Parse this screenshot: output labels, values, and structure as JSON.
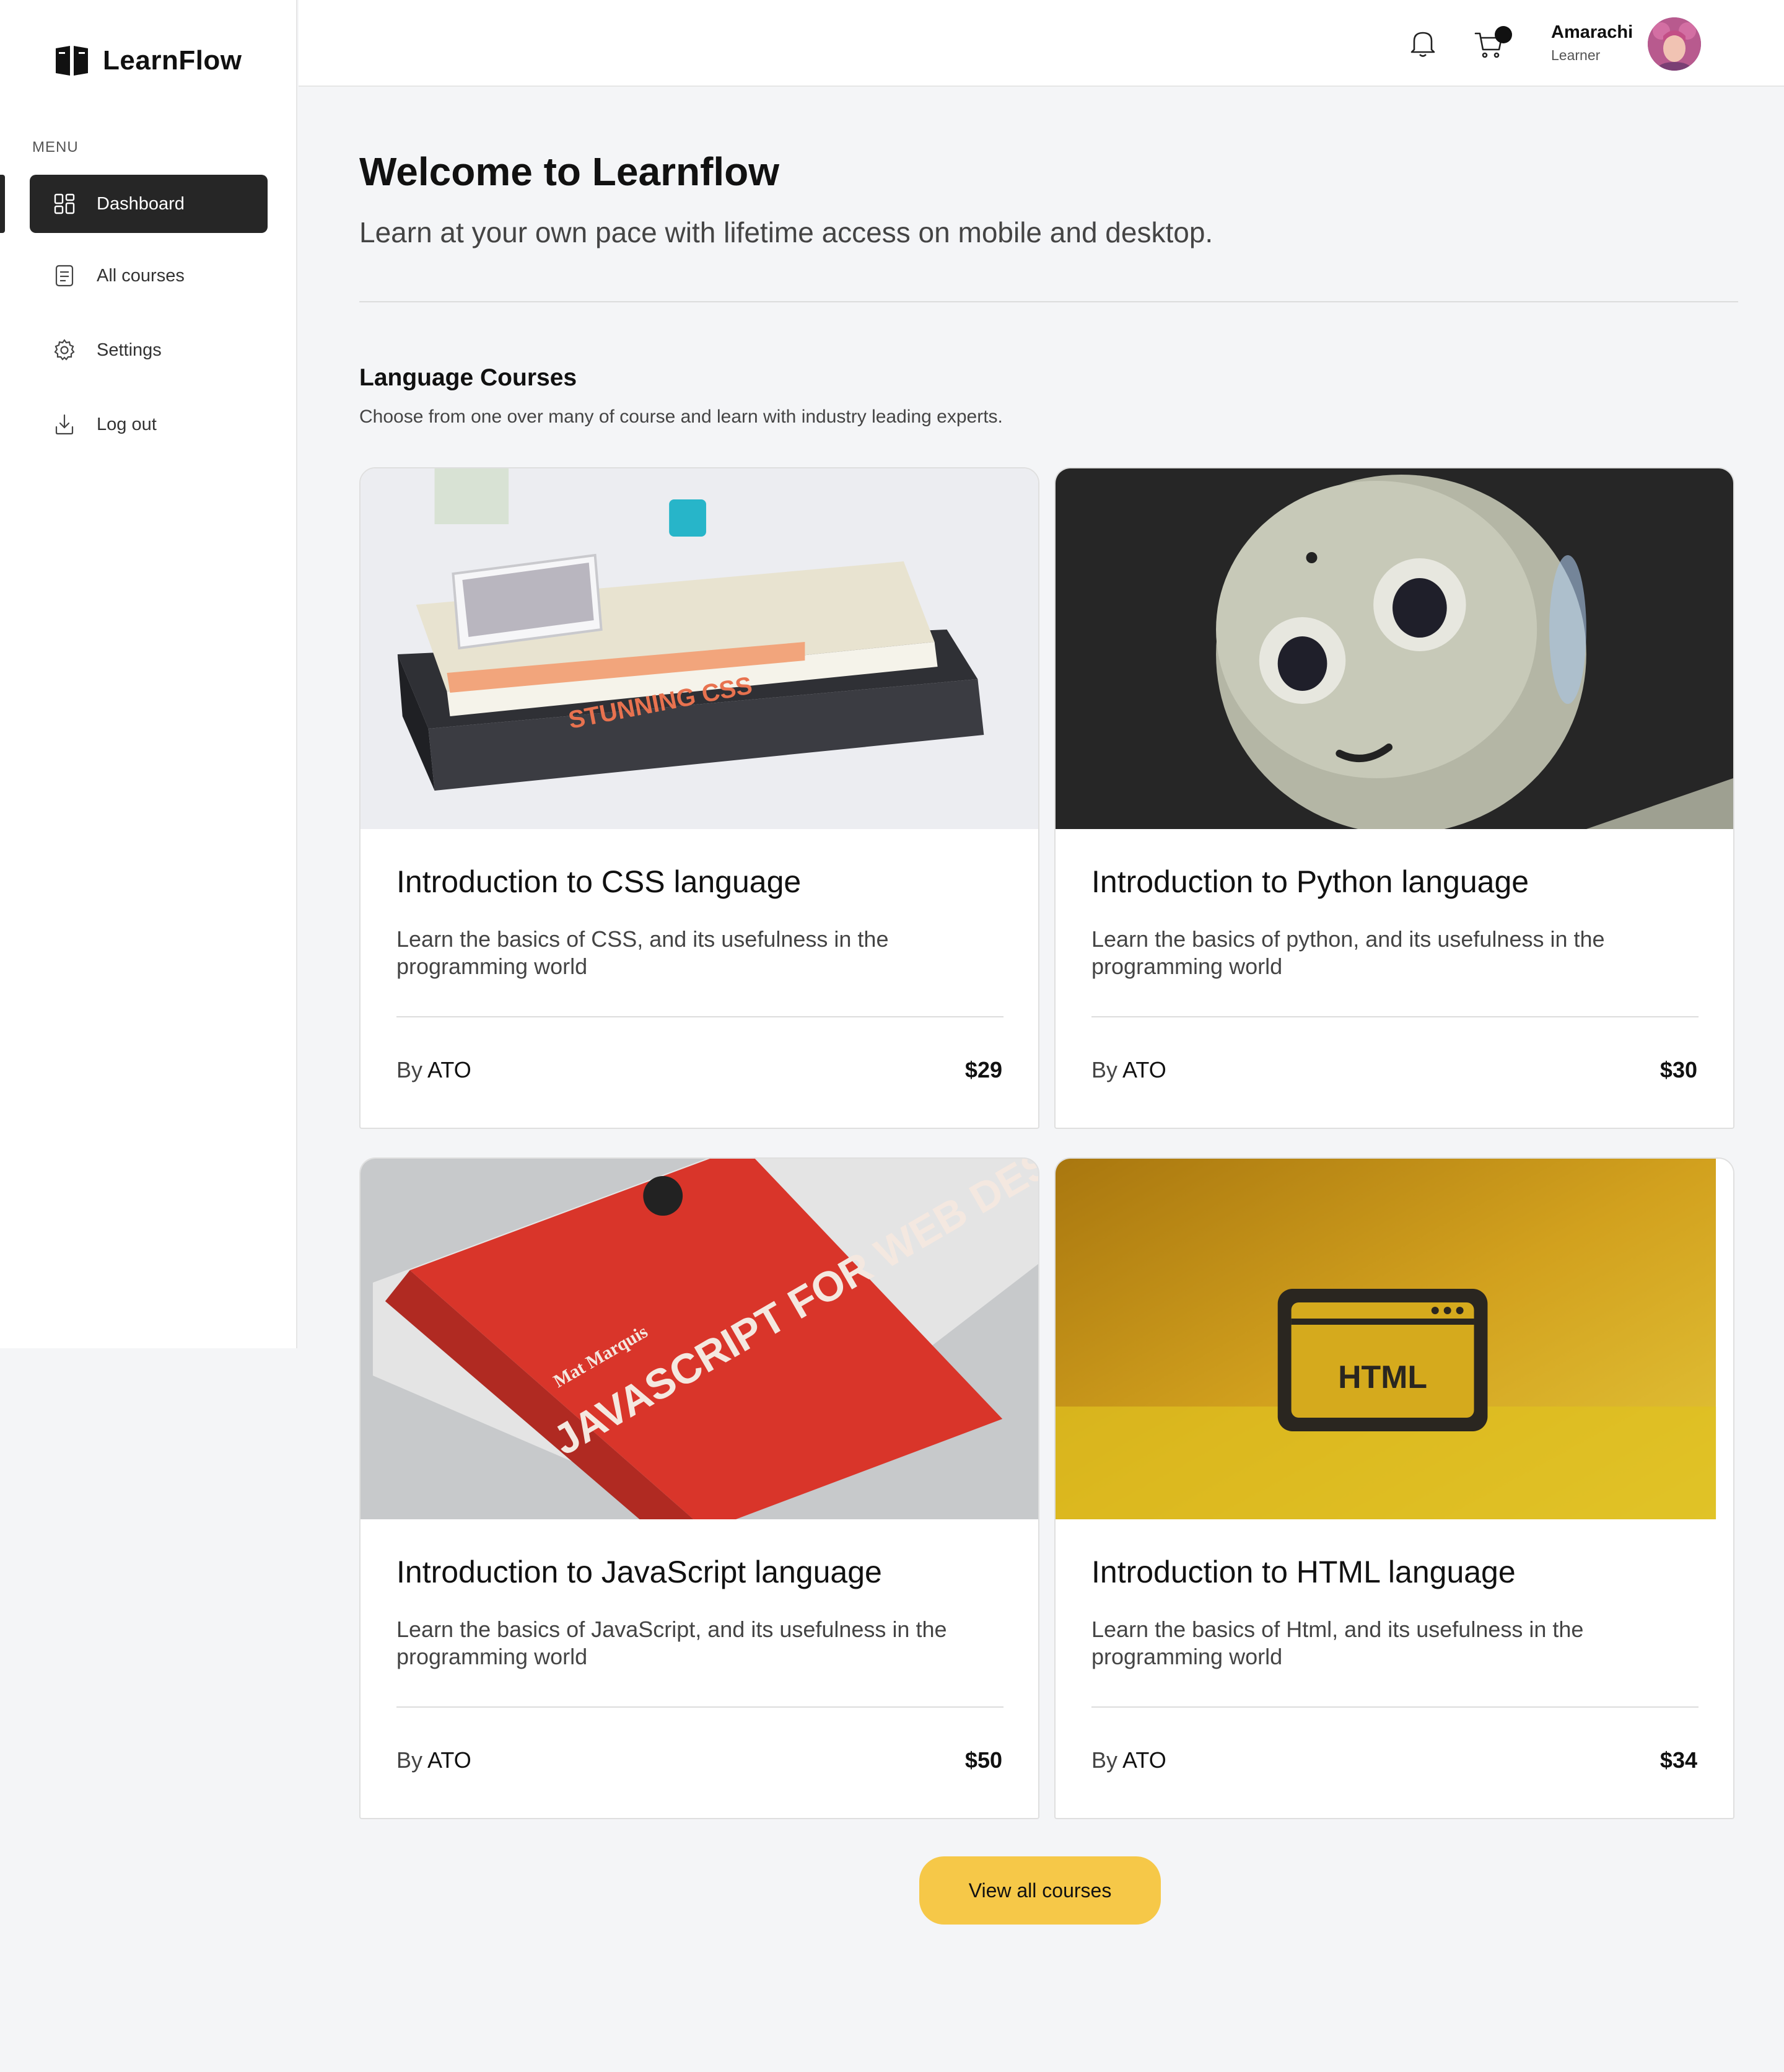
{
  "brand": {
    "name": "LearnFlow",
    "logo_icon": "open-book-icon"
  },
  "sidebar": {
    "menu_label": "MENU",
    "items": [
      {
        "label": "Dashboard",
        "icon": "dashboard-icon",
        "active": true
      },
      {
        "label": "All courses",
        "icon": "courses-icon",
        "active": false
      },
      {
        "label": "Settings",
        "icon": "gear-icon",
        "active": false
      },
      {
        "label": "Log out",
        "icon": "logout-icon",
        "active": false
      }
    ]
  },
  "header": {
    "notifications_icon": "bell-icon",
    "cart_icon": "cart-icon",
    "user": {
      "name": "Amarachi",
      "role": "Learner"
    }
  },
  "main": {
    "title": "Welcome to Learnflow",
    "subtitle": "Learn at your own pace with lifetime access on mobile and desktop.",
    "section": {
      "title": "Language Courses",
      "subtitle": "Choose from one over many of course and learn with industry leading experts."
    },
    "courses": [
      {
        "title": "Introduction to CSS language",
        "description": "Learn the basics of CSS, and its usefulness in the programming world",
        "by": "By",
        "author": "ATO",
        "price": "$29",
        "image": "css-books-photo"
      },
      {
        "title": "Introduction to Python language",
        "description": "Learn the basics of python, and its usefulness in the programming world",
        "by": "By",
        "author": "ATO",
        "price": "$30",
        "image": "robot-photo"
      },
      {
        "title": "Introduction to JavaScript language",
        "description": "Learn the basics of JavaScript, and its usefulness in the programming world",
        "by": "By",
        "author": "ATO",
        "price": "$50",
        "image": "javascript-book-photo"
      },
      {
        "title": "Introduction to HTML language",
        "description": "Learn the basics of Html, and its usefulness in the programming world",
        "by": "By",
        "author": "ATO",
        "price": "$34",
        "image": "html-sign-photo"
      }
    ],
    "image_text": {
      "css_book": "STUNNING CSS",
      "js_book_title": "JAVASCRIPT FOR WEB DESIGNERS",
      "js_book_author": "Mat Marquis",
      "html_sign": "HTML"
    },
    "view_all_label": "View all courses"
  },
  "colors": {
    "accent": "#f6c848",
    "active_nav": "#262626",
    "background": "#f4f5f7"
  }
}
